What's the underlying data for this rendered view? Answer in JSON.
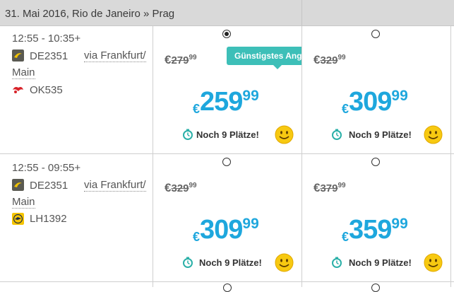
{
  "header": {
    "title": "31. Mai 2016, Rio de Janeiro » Prag"
  },
  "flights": [
    {
      "time": "12:55 - 10:35+",
      "legs": [
        {
          "code": "DE2351",
          "via": "via Frankfurt/",
          "via2": "Main",
          "airline_icon": "condor-icon"
        },
        {
          "code": "OK535",
          "airline_icon": "czech-airlines-icon"
        }
      ],
      "fares": [
        {
          "old_price": "279",
          "old_cents": "99",
          "price": "259",
          "cents": "99",
          "seats": "Noch 9 Plätze!",
          "selected": true
        },
        {
          "old_price": "329",
          "old_cents": "99",
          "price": "309",
          "cents": "99",
          "seats": "Noch 9 Plätze!",
          "selected": false
        }
      ]
    },
    {
      "time": "12:55 - 09:55+",
      "legs": [
        {
          "code": "DE2351",
          "via": "via Frankfurt/",
          "via2": "Main",
          "airline_icon": "condor-icon"
        },
        {
          "code": "LH1392",
          "airline_icon": "lufthansa-icon"
        }
      ],
      "fares": [
        {
          "old_price": "329",
          "old_cents": "99",
          "price": "309",
          "cents": "99",
          "seats": "Noch 9 Plätze!",
          "selected": false
        },
        {
          "old_price": "379",
          "old_cents": "99",
          "price": "359",
          "cents": "99",
          "seats": "Noch 9 Plätze!",
          "selected": false
        }
      ]
    }
  ],
  "currency": "€",
  "tooltip": {
    "label": "Günstigstes Ang"
  },
  "colors": {
    "price": "#1ea7dd",
    "tooltip": "#3dbfb8",
    "header_bg": "#d9d9d9"
  }
}
